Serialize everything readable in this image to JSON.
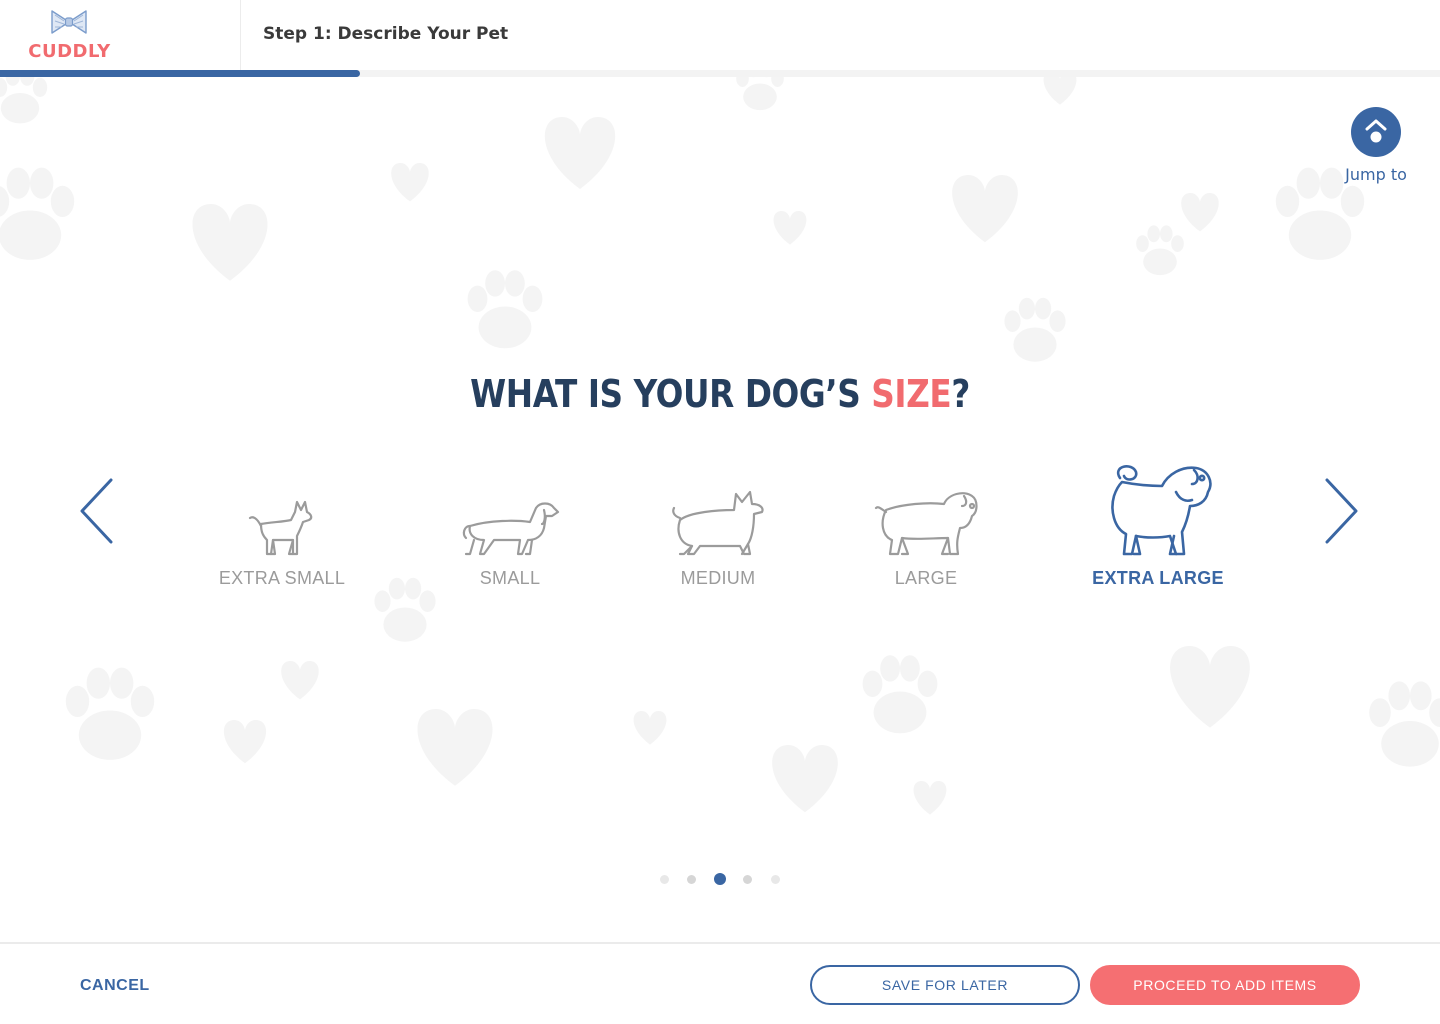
{
  "header": {
    "brand": "CUDDLY",
    "step_title": "Step 1: Describe Your Pet",
    "progress": 0.25
  },
  "jump_to": {
    "label": "Jump to",
    "icon": "jump-to-icon"
  },
  "question": {
    "prefix": "WHAT IS YOUR DOG’S ",
    "highlight": "SIZE",
    "suffix": "?"
  },
  "size_options": [
    {
      "label": "EXTRA SMALL",
      "icon": "chihuahua-icon",
      "selected": false
    },
    {
      "label": "SMALL",
      "icon": "dachshund-icon",
      "selected": false
    },
    {
      "label": "MEDIUM",
      "icon": "corgi-icon",
      "selected": false
    },
    {
      "label": "LARGE",
      "icon": "bulldog-icon",
      "selected": false
    },
    {
      "label": "EXTRA LARGE",
      "icon": "pug-icon",
      "selected": true
    }
  ],
  "pagination": {
    "count": 5,
    "active": 3
  },
  "footer": {
    "cancel_label": "CANCEL",
    "save_label": "SAVE FOR LATER",
    "proceed_label": "PROCEED TO ADD ITEMS"
  },
  "colors": {
    "brand_blue": "#3a66a3",
    "accent_coral": "#f16b6f",
    "muted_gray": "#9b9b9b"
  }
}
